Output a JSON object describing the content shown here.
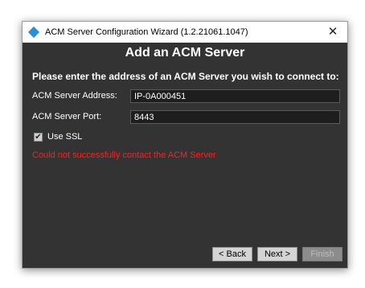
{
  "window": {
    "title": "ACM Server Configuration Wizard (1.2.21061.1047)",
    "close_glyph": "✕"
  },
  "page": {
    "heading": "Add an ACM Server",
    "prompt": "Please enter the address of an ACM Server you wish to connect to:"
  },
  "form": {
    "address_label": "ACM Server Address:",
    "address_value": "IP-0A000451",
    "port_label": "ACM Server Port:",
    "port_value": "8443",
    "ssl_label": "Use SSL",
    "ssl_checked": true,
    "ssl_check_glyph": "✔"
  },
  "error": {
    "message": "Could not successfully contact the ACM Server",
    "color": "#ff1f1f"
  },
  "buttons": {
    "back": "< Back",
    "next": "Next >",
    "finish": "Finish"
  },
  "colors": {
    "background": "#333333",
    "accent_icon": "#2a8fd6"
  },
  "icons": {
    "app": "acm-diamond-icon",
    "close": "close-icon",
    "check": "checkmark-icon"
  }
}
